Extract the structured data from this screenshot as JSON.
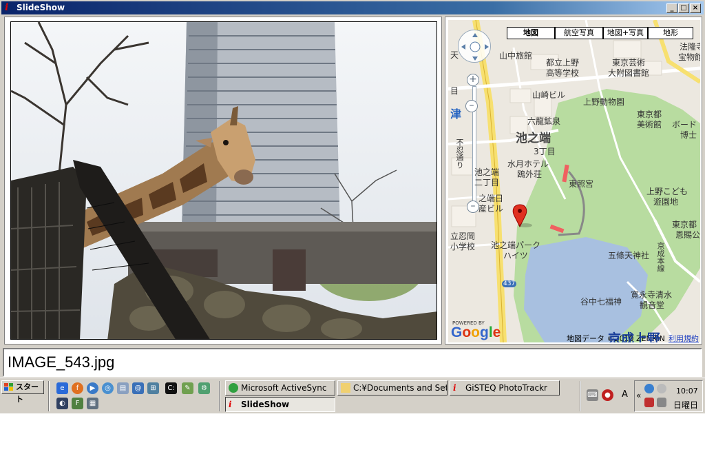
{
  "window": {
    "title": "SlideShow",
    "controls": {
      "minimize": "_",
      "maximize": "□",
      "close": "×"
    }
  },
  "photo": {
    "filename": "IMAGE_543.jpg"
  },
  "map": {
    "types": [
      "地図",
      "航空写真",
      "地図+写真",
      "地形"
    ],
    "active_type": "地図",
    "labels": {
      "l1": "天",
      "l2": "山中旅館",
      "l3": "都立上野",
      "l4": "高等学校",
      "l5": "東京芸術",
      "l6": "大附図書館",
      "l7": "法隆寺",
      "l8": "宝物館",
      "l9": "目",
      "l10": "山崎ビル",
      "l11": "上野動物園",
      "l12": "津",
      "l13": "六龍鉱泉",
      "l14": "東京都",
      "l15": "美術館",
      "l16": "ボード",
      "l17": "博士",
      "l18": "池之端",
      "l19": "3丁目",
      "l20": "水月ホテル",
      "l21": "鴎外荘",
      "l22": "池之端",
      "l23": "二丁目",
      "l24": "東照宮",
      "l25": "上野こども",
      "l26": "遊園地",
      "l27": "之端日",
      "l28": "産ビル",
      "l29": "東京都",
      "l30": "恩賜公",
      "l31": "立忍岡",
      "l32": "小学校",
      "l33": "池之端パーク",
      "l34": "ハイツ",
      "l35": "五條天神社",
      "l36": "京成本線",
      "l37": "寛永寺清水",
      "l38": "観音堂",
      "l39": "谷中七福神",
      "l40": "不忍通り",
      "l41": "437"
    },
    "station": "京成上野",
    "google_logo": "Google",
    "powered_by": "POWERED BY",
    "map_data": "地図データ ©2010 ZENRIN",
    "terms": "利用規約"
  },
  "taskbar": {
    "start_label": "スタート",
    "tasks": [
      {
        "label": "Microsoft ActiveSync",
        "icon": "sync-icon"
      },
      {
        "label": "C:¥Documents and Setti...",
        "icon": "folder-icon"
      },
      {
        "label": "GiSTEQ PhotoTrackr",
        "icon": "app-icon"
      },
      {
        "label": "SlideShow",
        "icon": "app-icon"
      }
    ],
    "clock_time": "10:07",
    "clock_day": "日曜日",
    "tray_chevron": "«",
    "ime_a": "A"
  },
  "colors": {
    "title_start": "#0a246a",
    "title_end": "#a6caf0",
    "water": "#a8c0e0",
    "park": "#b8dca0",
    "road": "#f7e070",
    "marker": "#e03020"
  }
}
